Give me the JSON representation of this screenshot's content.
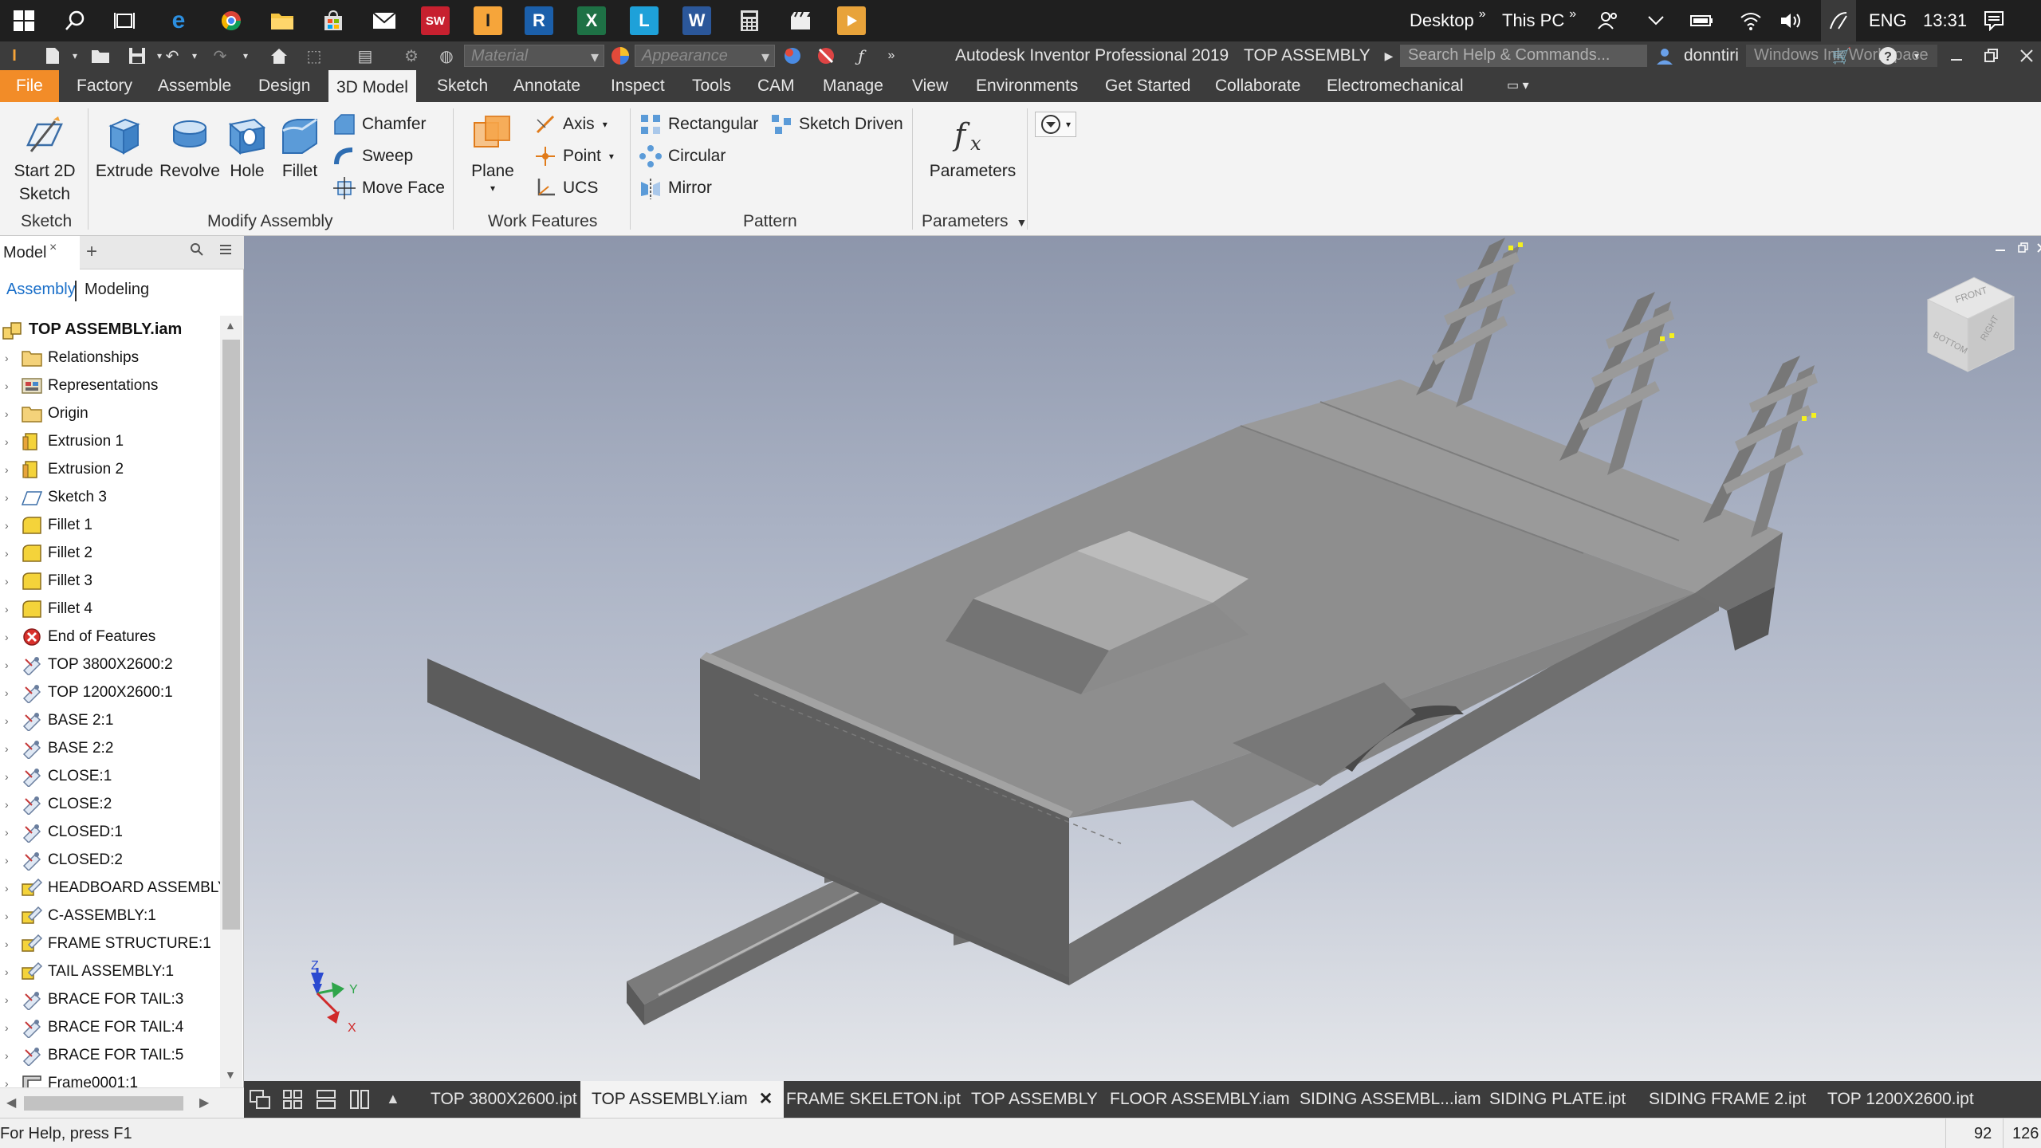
{
  "taskbar": {
    "desktop_label": "Desktop",
    "thispc_label": "This PC",
    "lang": "ENG",
    "time": "13:31"
  },
  "titlebar": {
    "material_placeholder": "Material",
    "appearance_placeholder": "Appearance",
    "app_title": "Autodesk Inventor Professional 2019",
    "doc_title": "TOP ASSEMBLY",
    "search_placeholder": "Search Help & Commands...",
    "user": "donntiri",
    "workspace": "Windows Ink Workspace"
  },
  "tabs": [
    "File",
    "Factory",
    "Assemble",
    "Design",
    "3D Model",
    "Sketch",
    "Annotate",
    "Inspect",
    "Tools",
    "CAM",
    "Manage",
    "View",
    "Environments",
    "Get Started",
    "Collaborate",
    "Electromechanical"
  ],
  "ribbon": {
    "start_2d_sketch": "Start 2D Sketch",
    "group_sketch": "Sketch",
    "extrude": "Extrude",
    "revolve": "Revolve",
    "hole": "Hole",
    "fillet": "Fillet",
    "chamfer": "Chamfer",
    "sweep": "Sweep",
    "move_face": "Move Face",
    "group_modify": "Modify Assembly",
    "plane": "Plane",
    "axis": "Axis",
    "point": "Point",
    "ucs": "UCS",
    "group_work": "Work Features",
    "rectangular": "Rectangular",
    "sketch_driven": "Sketch Driven",
    "circular": "Circular",
    "mirror": "Mirror",
    "group_pattern": "Pattern",
    "parameters": "Parameters",
    "group_parameters": "Parameters"
  },
  "browser": {
    "tab": "Model",
    "sub_assembly": "Assembly",
    "sub_modeling": "Modeling",
    "root": "TOP ASSEMBLY.iam",
    "items": [
      {
        "label": "Relationships",
        "icon": "folder-icon"
      },
      {
        "label": "Representations",
        "icon": "representations-icon"
      },
      {
        "label": "Origin",
        "icon": "folder-icon"
      },
      {
        "label": "Extrusion 1",
        "icon": "extrusion-icon"
      },
      {
        "label": "Extrusion 2",
        "icon": "extrusion-icon"
      },
      {
        "label": "Sketch 3",
        "icon": "sketch-icon"
      },
      {
        "label": "Fillet 1",
        "icon": "fillet-icon"
      },
      {
        "label": "Fillet 2",
        "icon": "fillet-icon"
      },
      {
        "label": "Fillet 3",
        "icon": "fillet-icon"
      },
      {
        "label": "Fillet 4",
        "icon": "fillet-icon"
      },
      {
        "label": "End of Features",
        "icon": "end-of-features-icon"
      },
      {
        "label": "TOP 3800X2600:2",
        "icon": "part-icon"
      },
      {
        "label": "TOP 1200X2600:1",
        "icon": "part-icon"
      },
      {
        "label": "BASE 2:1",
        "icon": "part-icon"
      },
      {
        "label": "BASE 2:2",
        "icon": "part-icon"
      },
      {
        "label": "CLOSE:1",
        "icon": "part-icon"
      },
      {
        "label": "CLOSE:2",
        "icon": "part-icon"
      },
      {
        "label": "CLOSED:1",
        "icon": "part-icon"
      },
      {
        "label": "CLOSED:2",
        "icon": "part-icon"
      },
      {
        "label": "HEADBOARD ASSEMBLY:",
        "icon": "assembly-icon"
      },
      {
        "label": "C-ASSEMBLY:1",
        "icon": "assembly-icon"
      },
      {
        "label": "FRAME STRUCTURE:1",
        "icon": "assembly-icon"
      },
      {
        "label": "TAIL ASSEMBLY:1",
        "icon": "assembly-icon"
      },
      {
        "label": "BRACE FOR TAIL:3",
        "icon": "part-icon"
      },
      {
        "label": "BRACE FOR TAIL:4",
        "icon": "part-icon"
      },
      {
        "label": "BRACE FOR TAIL:5",
        "icon": "part-icon"
      },
      {
        "label": "Frame0001:1",
        "icon": "frame-icon"
      }
    ]
  },
  "viewcube": {
    "front": "FRONT",
    "bottom": "BOTTOM",
    "right": "RIGHT"
  },
  "triad": {
    "x": "X",
    "y": "Y",
    "z": "Z"
  },
  "doctabs": [
    "TOP 3800X2600.ipt",
    "TOP ASSEMBLY.iam",
    "FRAME SKELETON.ipt",
    "TOP ASSEMBLY",
    "FLOOR ASSEMBLY.iam",
    "SIDING ASSEMBL...iam",
    "SIDING PLATE.ipt",
    "SIDING FRAME 2.ipt",
    "TOP 1200X2600.ipt"
  ],
  "status": {
    "help": "For Help, press F1",
    "count1": "92",
    "count2": "126"
  },
  "colors": {
    "file_tab": "#f28c28",
    "dark_bar": "#3c3c3c",
    "model_gray": "#8f8f8f",
    "accent_blue": "#1a6fc9"
  }
}
